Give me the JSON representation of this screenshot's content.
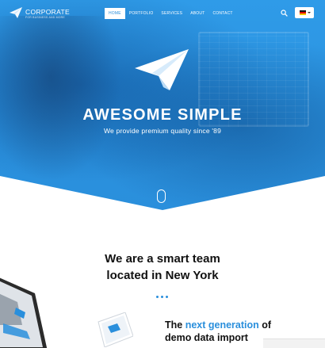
{
  "brand": {
    "name": "CORPORATE",
    "tagline": "FOR BUSINESS AND MORE"
  },
  "nav": {
    "items": [
      {
        "label": "HOME",
        "active": true
      },
      {
        "label": "PORTFOLIO",
        "active": false
      },
      {
        "label": "SERVICES",
        "active": false
      },
      {
        "label": "ABOUT",
        "active": false
      },
      {
        "label": "CONTACT",
        "active": false
      }
    ],
    "search_icon": "search-icon",
    "language_icon": "german-flag-icon"
  },
  "hero": {
    "title": "AWESOME SIMPLE",
    "subtitle": "We provide premium quality since '89",
    "icon": "paper-plane-icon",
    "scroll_icon": "mouse-scroll-icon"
  },
  "about": {
    "title_line1": "We are a smart team",
    "title_line2": "located in New York"
  },
  "feature": {
    "prefix": "The ",
    "highlight": "next generation",
    "suffix": " of",
    "line2": "demo data import"
  },
  "colors": {
    "accent": "#2a8fdc",
    "hero_blue": "#2f9be8",
    "text_dark": "#111111",
    "white": "#ffffff"
  }
}
